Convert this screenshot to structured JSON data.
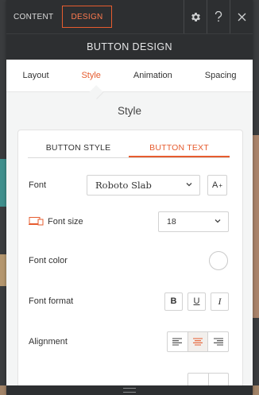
{
  "top_tabs": {
    "content": "CONTENT",
    "design": "DESIGN"
  },
  "title": "BUTTON DESIGN",
  "sub_tabs": [
    "Layout",
    "Style",
    "Animation",
    "Spacing"
  ],
  "section_title": "Style",
  "card_tabs": [
    "BUTTON STYLE",
    "BUTTON TEXT"
  ],
  "font": {
    "label": "Font",
    "value": "Roboto Slab",
    "plus_label": "A"
  },
  "font_size": {
    "label": "Font size",
    "value": "18"
  },
  "font_color": {
    "label": "Font color"
  },
  "font_format": {
    "label": "Font format",
    "bold": "B",
    "underline": "U",
    "italic": "I"
  },
  "alignment": {
    "label": "Alignment",
    "selected": "center"
  },
  "colors": {
    "accent": "#e65c2f",
    "dark": "#2d2f31"
  }
}
